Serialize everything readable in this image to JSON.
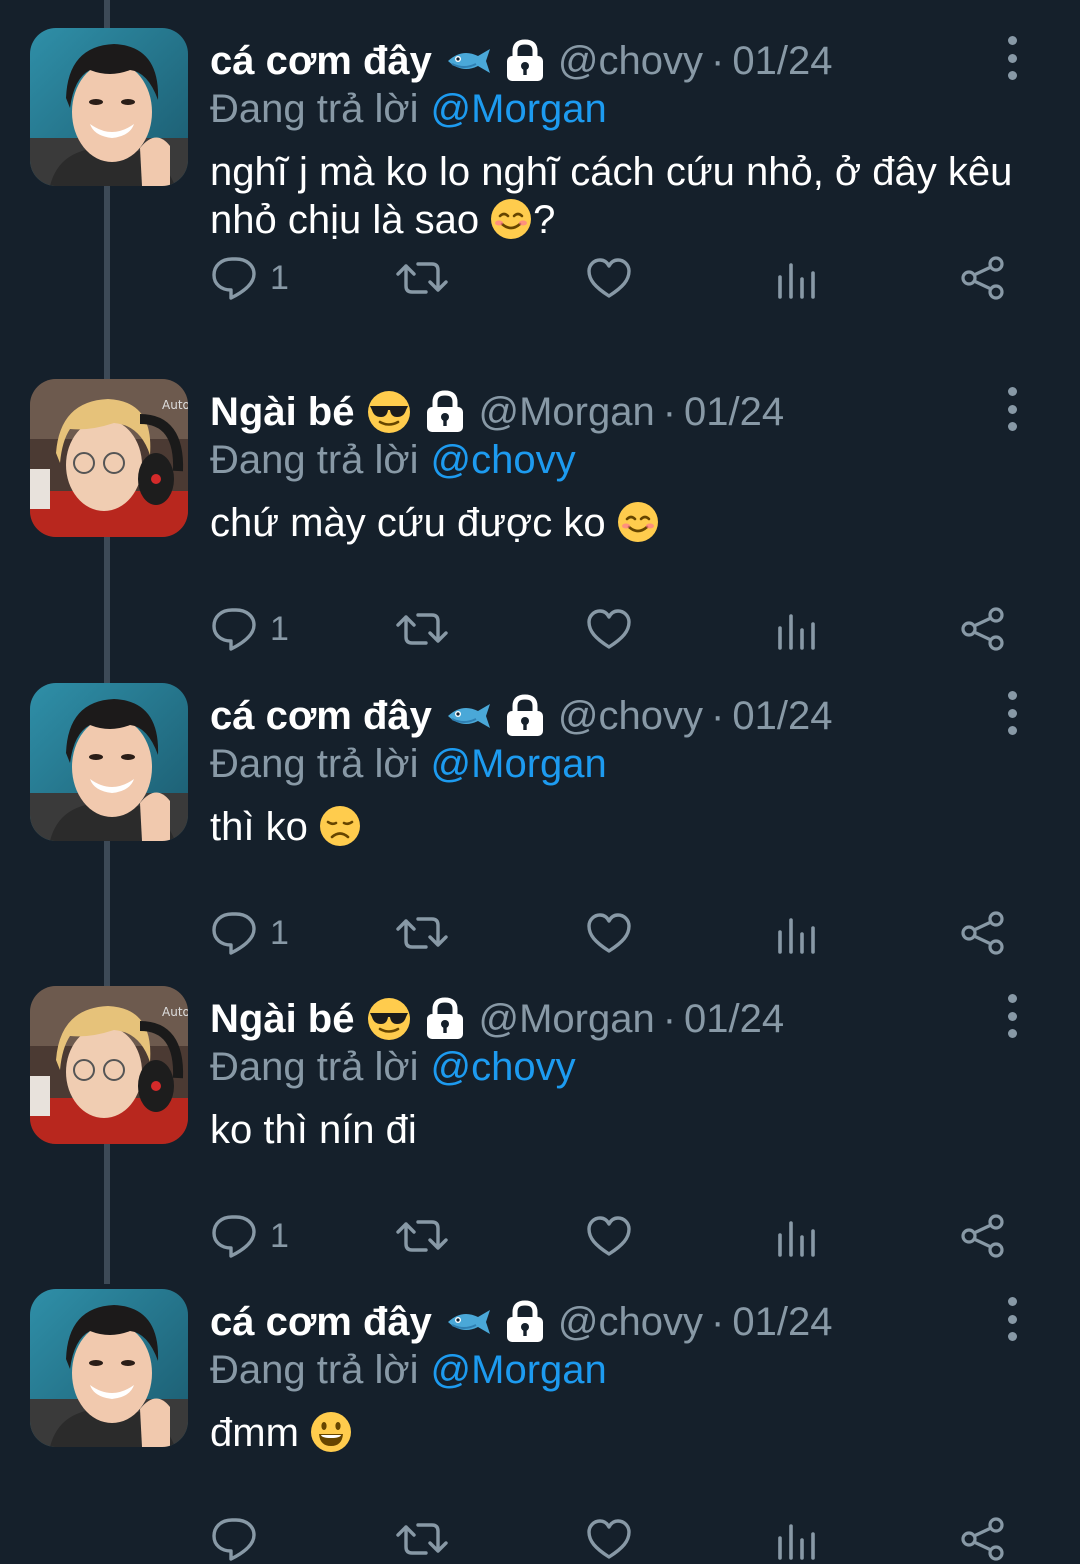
{
  "tweets": [
    {
      "display_name": "cá cơm đây",
      "name_emoji": "fish-emoji",
      "handle": "@chovy",
      "separator": "·",
      "date": "01/24",
      "reply_prefix": "Đang trả lời",
      "reply_to": "@Morgan",
      "text": "nghĩ j mà ko lo nghĩ cách cứu nhỏ, ở đây kêu nhỏ chịu là sao",
      "text_suffix": "?",
      "text_emoji": "smiling-blush-emoji",
      "reply_count": "1"
    },
    {
      "display_name": "Ngài bé",
      "name_emoji": "sunglasses-emoji",
      "handle": "@Morgan",
      "separator": "·",
      "date": "01/24",
      "reply_prefix": "Đang trả lời",
      "reply_to": "@chovy",
      "text": "chứ mày cứu được ko",
      "text_suffix": "",
      "text_emoji": "smiling-blush-emoji",
      "reply_count": "1"
    },
    {
      "display_name": "cá cơm đây",
      "name_emoji": "fish-emoji",
      "handle": "@chovy",
      "separator": "·",
      "date": "01/24",
      "reply_prefix": "Đang trả lời",
      "reply_to": "@Morgan",
      "text": "thì ko",
      "text_suffix": "",
      "text_emoji": "disappointed-emoji",
      "reply_count": "1"
    },
    {
      "display_name": "Ngài bé",
      "name_emoji": "sunglasses-emoji",
      "handle": "@Morgan",
      "separator": "·",
      "date": "01/24",
      "reply_prefix": "Đang trả lời",
      "reply_to": "@chovy",
      "text": "ko thì nín đi",
      "text_suffix": "",
      "text_emoji": "",
      "reply_count": "1"
    },
    {
      "display_name": "cá cơm đây",
      "name_emoji": "fish-emoji",
      "handle": "@chovy",
      "separator": "·",
      "date": "01/24",
      "reply_prefix": "Đang trả lời",
      "reply_to": "@Morgan",
      "text": "đmm",
      "text_suffix": "",
      "text_emoji": "grinning-emoji",
      "reply_count": ""
    }
  ],
  "colors": {
    "background": "#15202b",
    "secondary_text": "#8899a6",
    "link": "#1d9bf0",
    "thread_line": "#3d4a57"
  }
}
